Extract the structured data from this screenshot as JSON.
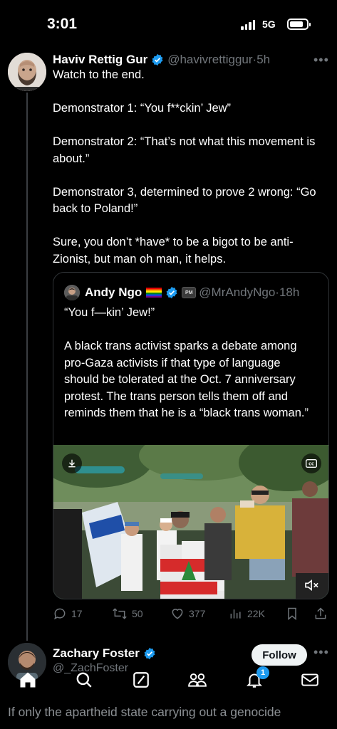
{
  "status_bar": {
    "time": "3:01",
    "network": "5G",
    "battery_level": 0.8
  },
  "main_tweet": {
    "author_name": "Haviv Rettig Gur",
    "handle": "@havivrettiggur",
    "separator": "·",
    "time_ago": "5h",
    "text": "Watch to the end.\n\nDemonstrator 1: “You f**ckin’ Jew”\n\nDemonstrator 2: “That’s not what this movement is about.”\n\nDemonstrator 3, determined to prove 2 wrong: “Go back to Poland!”\n\nSure, you don’t *have* to be a bigot to be anti-Zionist, but man oh man, it helps.",
    "more_icon": "ellipsis-icon"
  },
  "quoted_tweet": {
    "author_name": "Andy Ngo",
    "affiliate_badge": "PM",
    "handle": "@MrAndyNgo",
    "separator": "·",
    "time_ago": "18h",
    "text": "“You f—kin’ Jew!”\n\nA black trans activist sparks a debate among pro-Gaza activists if that type of language should be tolerated at the Oct. 7 anniversary protest. The trans person tells them off and reminds them that he is a “black trans woman.”",
    "video_icons": [
      "download-icon",
      "closed-captions-icon",
      "mute-icon"
    ]
  },
  "actions": {
    "replies": "17",
    "reposts": "50",
    "likes": "377",
    "views": "22K"
  },
  "second_tweet": {
    "author_name": "Zachary Foster",
    "handle": "@_ZachFoster",
    "follow_label": "Follow",
    "text": "If only the apartheid state carrying out a genocide"
  },
  "tab_bar": {
    "items": [
      "home-icon",
      "search-icon",
      "grok-icon",
      "communities-icon",
      "notifications-icon",
      "messages-icon"
    ],
    "notification_count": "1"
  },
  "colors": {
    "accent": "#1d9bf0",
    "background": "#000000",
    "muted": "#71767b"
  }
}
